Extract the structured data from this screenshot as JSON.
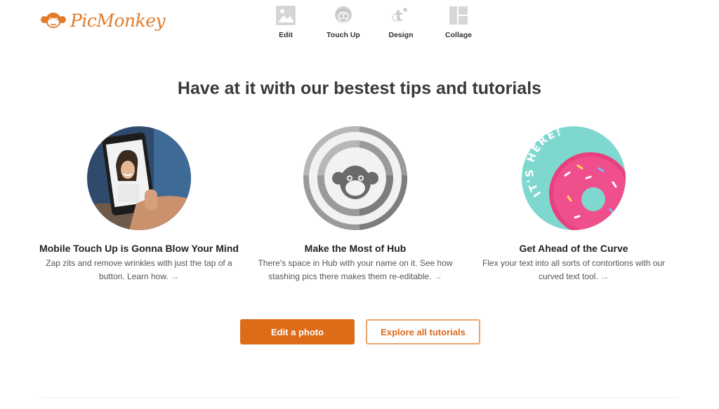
{
  "brand": {
    "name": "PicMonkey",
    "color": "#e07b2a"
  },
  "nav": {
    "items": [
      {
        "label": "Edit",
        "icon": "image-icon"
      },
      {
        "label": "Touch Up",
        "icon": "face-icon"
      },
      {
        "label": "Design",
        "icon": "design-icon"
      },
      {
        "label": "Collage",
        "icon": "collage-icon"
      }
    ]
  },
  "main": {
    "headline": "Have at it with our bestest tips and tutorials",
    "cards": [
      {
        "title": "Mobile Touch Up is Gonna Blow Your Mind",
        "desc": "Zap zits and remove wrinkles with just the tap of a button. Learn how.",
        "arrow": "→"
      },
      {
        "title": "Make the Most of Hub",
        "desc": "There's space in Hub with your name on it. See how stashing pics there makes them re-editable.",
        "arrow": "→"
      },
      {
        "title": "Get Ahead of the Curve",
        "desc": "Flex your text into all sorts of contortions with our curved text tool.",
        "arrow": "→"
      }
    ],
    "donut_badge": "IT'S HERE!"
  },
  "actions": {
    "primary_label": "Edit a photo",
    "secondary_label": "Explore all tutorials"
  },
  "colors": {
    "accent": "#dd6b17",
    "text": "#333333"
  }
}
